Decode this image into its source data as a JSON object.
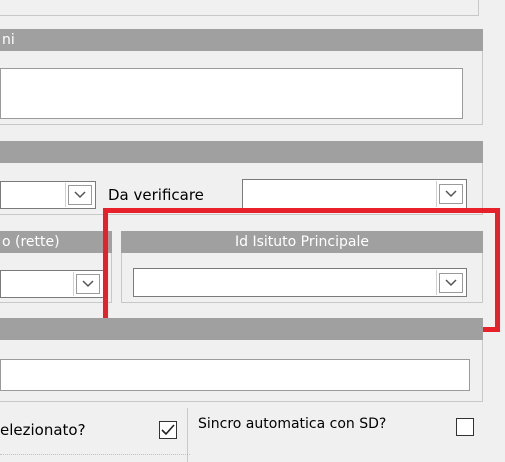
{
  "sections": {
    "top_header_partial": "ni",
    "second_header": "",
    "rette_header_partial": "o (rette)",
    "id_istituto_header": "Id Isituto Principale",
    "fourth_header": ""
  },
  "fields": {
    "da_verificare_label": "Da verificare",
    "selezionato_label": "elezionato?",
    "sincro_label": "Sincro automatica con SD?"
  },
  "states": {
    "selezionato_checked": true,
    "sincro_checked": false
  },
  "colors": {
    "header_bg": "#a0a0a0",
    "highlight": "#e8202a"
  },
  "icons": [
    "chevron-down-icon",
    "check-icon"
  ]
}
